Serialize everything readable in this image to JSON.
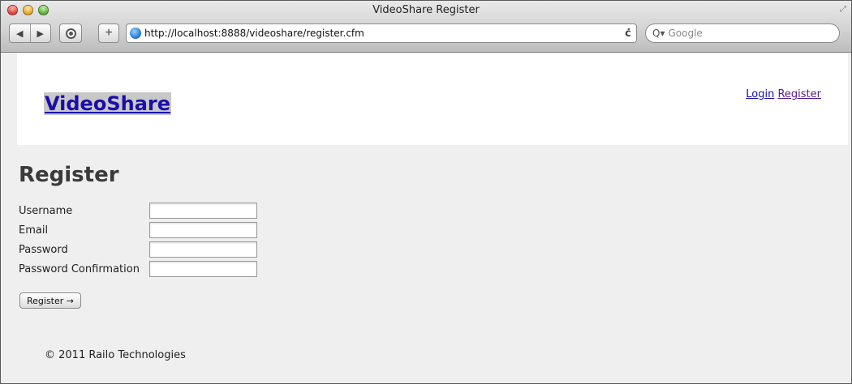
{
  "window": {
    "title": "VideoShare Register"
  },
  "toolbar": {
    "back_glyph": "◀",
    "forward_glyph": "▶",
    "add_glyph": "+",
    "url": "http://localhost:8888/videoshare/register.cfm",
    "reload_glyph": "ċ",
    "search_placeholder": "Google",
    "search_glyph": "Q▾"
  },
  "header": {
    "brand": "VideoShare",
    "nav": [
      {
        "label": "Login"
      },
      {
        "label": "Register"
      }
    ]
  },
  "page": {
    "title": "Register",
    "fields": [
      {
        "label": "Username",
        "value": ""
      },
      {
        "label": "Email",
        "value": ""
      },
      {
        "label": "Password",
        "value": ""
      },
      {
        "label": "Password Confirmation",
        "value": ""
      }
    ],
    "submit_label": "Register →",
    "footer": "© 2011 Railo Technologies"
  },
  "colors": {
    "link": "#1a0dab",
    "visited_link": "#551a8b",
    "page_background": "#efefef",
    "header_background": "#ffffff"
  }
}
